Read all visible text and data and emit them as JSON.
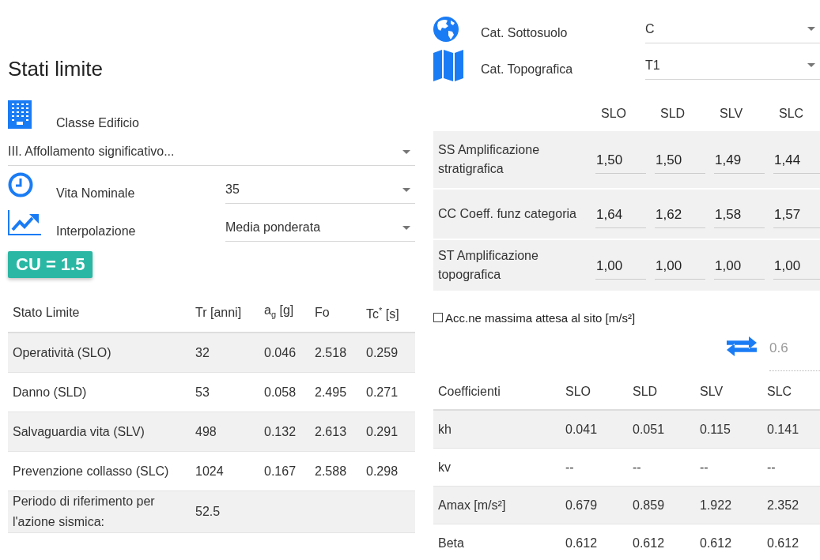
{
  "title": "Stati limite",
  "classe_edificio": {
    "label": "Classe Edificio",
    "value": "III. Affollamento significativo..."
  },
  "vita_nominale": {
    "label": "Vita Nominale",
    "value": "35"
  },
  "interpolazione": {
    "label": "Interpolazione",
    "value": "Media ponderata"
  },
  "cu_badge": "CU = 1.5",
  "limit_states_table": {
    "columns": [
      "Stato Limite",
      "Tr [anni]",
      "a$_{g}$ [g]",
      "Fo",
      "Tc$^{*}$ [s]"
    ],
    "rows": [
      {
        "cells": [
          "Operatività (SLO)",
          "32",
          "0.046",
          "2.518",
          "0.259"
        ]
      },
      {
        "cells": [
          "Danno (SLD)",
          "53",
          "0.058",
          "2.495",
          "0.271"
        ]
      },
      {
        "cells": [
          "Salvaguardia vita (SLV)",
          "498",
          "0.132",
          "2.613",
          "0.291"
        ]
      },
      {
        "cells": [
          "Prevenzione collasso (SLC)",
          "1024",
          "0.167",
          "2.588",
          "0.298"
        ]
      },
      {
        "cells": [
          "Periodo di riferimento per l'azione sismica:",
          "52.5"
        ]
      }
    ]
  },
  "site": [
    {
      "label": "Cat. Sottosuolo",
      "value": "C"
    },
    {
      "label": "Cat. Topografica",
      "value": "T1"
    }
  ],
  "amplification_table": {
    "columns": [
      "SLO",
      "SLD",
      "SLV",
      "SLC"
    ],
    "rows": [
      {
        "label": "SS Amplificazione stratigrafica",
        "values": [
          "1,50",
          "1,50",
          "1,49",
          "1,44"
        ]
      },
      {
        "label": "CC Coeff. funz categoria",
        "values": [
          "1,64",
          "1,62",
          "1,58",
          "1,57"
        ]
      },
      {
        "label": "ST Amplificazione topografica",
        "values": [
          "1,00",
          "1,00",
          "1,00",
          "1,00"
        ]
      }
    ]
  },
  "max_acceleration": {
    "label": "Acc.ne massima attesa al sito [m/s²]",
    "checked": false,
    "value": "0.6",
    "disabled": true
  },
  "coefficients_table": {
    "columns": [
      "Coefficienti",
      "SLO",
      "SLD",
      "SLV",
      "SLC"
    ],
    "rows": [
      {
        "cells": [
          "kh",
          "0.041",
          "0.051",
          "0.115",
          "0.141"
        ]
      },
      {
        "cells": [
          "kv",
          "--",
          "--",
          "--",
          "--"
        ]
      },
      {
        "cells": [
          "Amax [m/s²]",
          "0.679",
          "0.859",
          "1.922",
          "2.352"
        ]
      },
      {
        "cells": [
          "Beta",
          "0.612",
          "0.612",
          "0.612",
          "0.612"
        ]
      }
    ]
  }
}
